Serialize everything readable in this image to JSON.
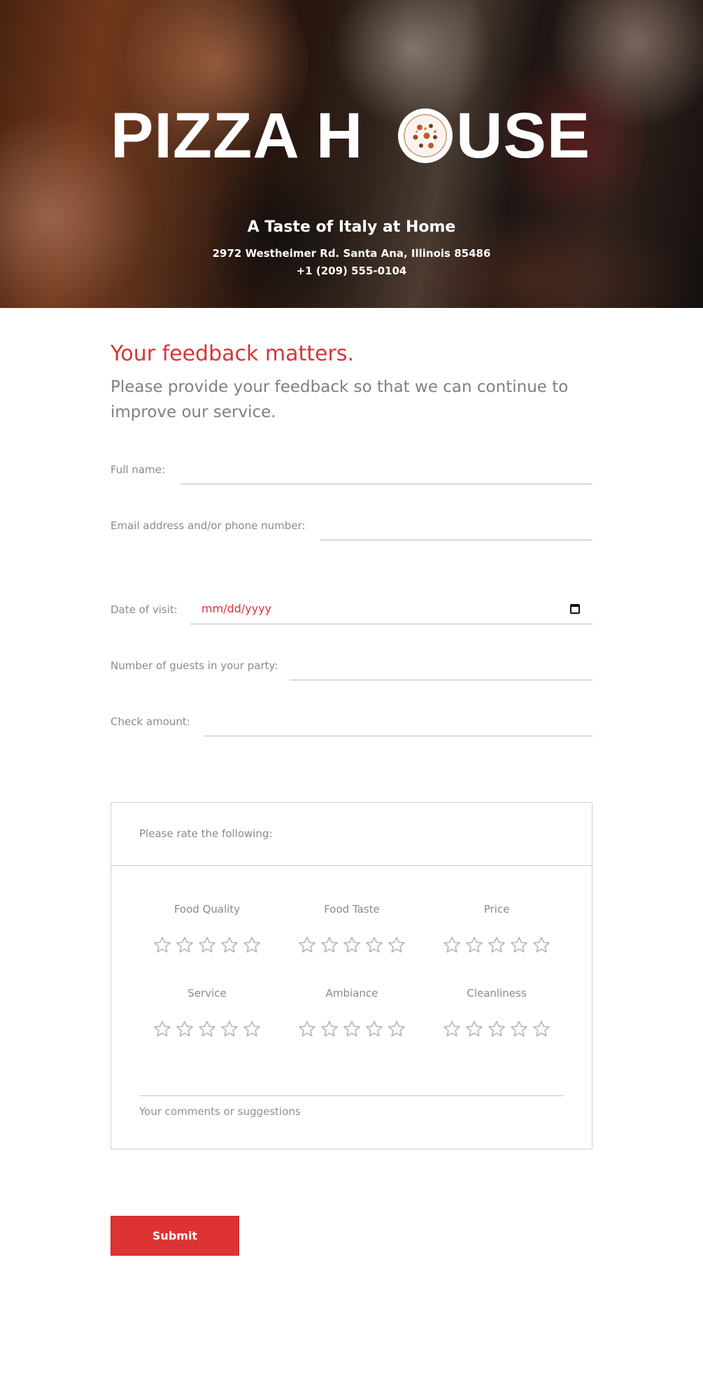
{
  "brand": {
    "logo_text": "PIZZA HOUSE",
    "logo_part_a": "PIZZA H",
    "logo_part_b": "USE",
    "tagline": "A Taste of Italy at Home",
    "address": "2972 Westheimer Rd. Santa Ana, Illinois 85486",
    "phone": "+1 (209) 555-0104"
  },
  "intro": {
    "title": "Your feedback matters.",
    "subtitle": "Please provide your feedback so that we can continue to improve our service."
  },
  "form": {
    "full_name_label": "Full name:",
    "contact_label": "Email address and/or phone number:",
    "date_label": "Date of visit:",
    "date_placeholder": "mm/dd/yyyy",
    "guests_label": "Number of guests in your party:",
    "check_label": "Check amount:"
  },
  "ratings": {
    "heading": "Please rate the following:",
    "items": [
      {
        "label": "Food Quality",
        "stars": 0,
        "max": 5
      },
      {
        "label": "Food Taste",
        "stars": 0,
        "max": 5
      },
      {
        "label": "Price",
        "stars": 0,
        "max": 5
      },
      {
        "label": "Service",
        "stars": 0,
        "max": 5
      },
      {
        "label": "Ambiance",
        "stars": 0,
        "max": 5
      },
      {
        "label": "Cleanliness",
        "stars": 0,
        "max": 5
      }
    ],
    "comments_placeholder": "Your comments or suggestions"
  },
  "submit_label": "Submit",
  "colors": {
    "accent": "#d63638",
    "button": "#dd3333",
    "star_outline": "#b5b5b5"
  },
  "icons": {
    "star": "star-outline-icon",
    "calendar": "calendar-icon",
    "logo_pizza": "pizza-icon"
  }
}
